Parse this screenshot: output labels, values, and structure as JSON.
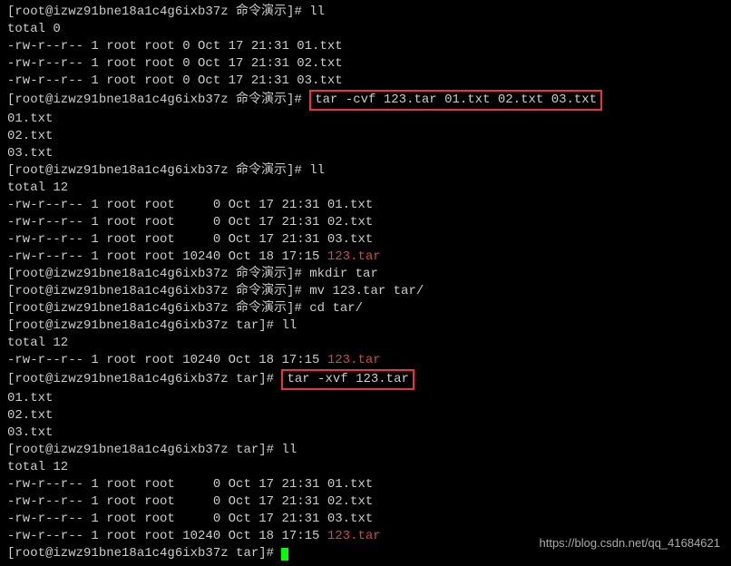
{
  "lines": {
    "l0": "[root@izwz91bne18a1c4g6ixb37z 命令演示]# ll",
    "l1": "total 0",
    "l2": "-rw-r--r-- 1 root root 0 Oct 17 21:31 01.txt",
    "l3": "-rw-r--r-- 1 root root 0 Oct 17 21:31 02.txt",
    "l4": "-rw-r--r-- 1 root root 0 Oct 17 21:31 03.txt",
    "l5_prompt": "[root@izwz91bne18a1c4g6ixb37z 命令演示]# ",
    "l5_cmd": "tar -cvf 123.tar 01.txt 02.txt 03.txt",
    "l6": "01.txt",
    "l7": "02.txt",
    "l8": "03.txt",
    "l9": "[root@izwz91bne18a1c4g6ixb37z 命令演示]# ll",
    "l10": "total 12",
    "l11": "-rw-r--r-- 1 root root     0 Oct 17 21:31 01.txt",
    "l12": "-rw-r--r-- 1 root root     0 Oct 17 21:31 02.txt",
    "l13": "-rw-r--r-- 1 root root     0 Oct 17 21:31 03.txt",
    "l14a": "-rw-r--r-- 1 root root 10240 Oct 18 17:15 ",
    "l14b": "123.tar",
    "l15": "[root@izwz91bne18a1c4g6ixb37z 命令演示]# mkdir tar",
    "l16": "[root@izwz91bne18a1c4g6ixb37z 命令演示]# mv 123.tar tar/",
    "l17": "[root@izwz91bne18a1c4g6ixb37z 命令演示]# cd tar/",
    "l18": "[root@izwz91bne18a1c4g6ixb37z tar]# ll",
    "l19": "total 12",
    "l20a": "-rw-r--r-- 1 root root 10240 Oct 18 17:15 ",
    "l20b": "123.tar",
    "l21_prompt": "[root@izwz91bne18a1c4g6ixb37z tar]# ",
    "l21_cmd": "tar -xvf 123.tar",
    "l22": "01.txt",
    "l23": "02.txt",
    "l24": "03.txt",
    "l25": "[root@izwz91bne18a1c4g6ixb37z tar]# ll",
    "l26": "total 12",
    "l27": "-rw-r--r-- 1 root root     0 Oct 17 21:31 01.txt",
    "l28": "-rw-r--r-- 1 root root     0 Oct 17 21:31 02.txt",
    "l29": "-rw-r--r-- 1 root root     0 Oct 17 21:31 03.txt",
    "l30a": "-rw-r--r-- 1 root root 10240 Oct 18 17:15 ",
    "l30b": "123.tar",
    "l31": "[root@izwz91bne18a1c4g6ixb37z tar]# "
  },
  "watermark": "https://blog.csdn.net/qq_41684621"
}
